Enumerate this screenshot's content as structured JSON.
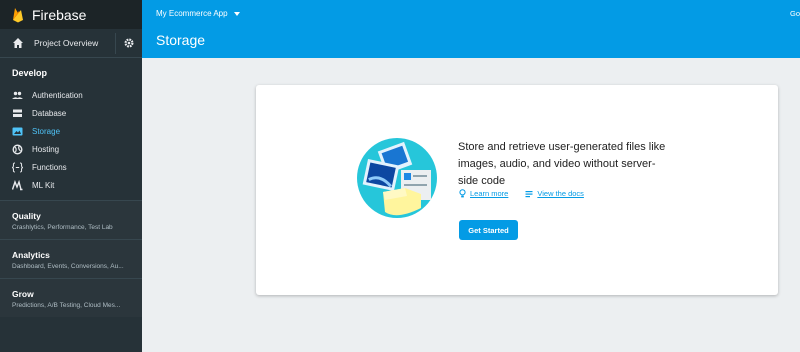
{
  "app": {
    "name": "Firebase"
  },
  "sidebar": {
    "project_overview": "Project Overview",
    "develop": {
      "title": "Develop",
      "items": [
        {
          "label": "Authentication",
          "icon": "people-icon"
        },
        {
          "label": "Database",
          "icon": "database-icon"
        },
        {
          "label": "Storage",
          "icon": "image-folder-icon",
          "active": true
        },
        {
          "label": "Hosting",
          "icon": "globe-icon"
        },
        {
          "label": "Functions",
          "icon": "functions-icon"
        },
        {
          "label": "ML Kit",
          "icon": "ml-kit-icon"
        }
      ]
    },
    "groups": [
      {
        "title": "Quality",
        "subtitle": "Crashlytics, Performance, Test Lab"
      },
      {
        "title": "Analytics",
        "subtitle": "Dashboard, Events, Conversions, Au..."
      },
      {
        "title": "Grow",
        "subtitle": "Predictions, A/B Testing, Cloud Mes..."
      }
    ]
  },
  "header": {
    "project": "My Ecommerce App",
    "title": "Storage",
    "right_text": "Go"
  },
  "card": {
    "description": "Store and retrieve user-generated files like images, audio, and video without server-side code",
    "learn_more": "Learn more",
    "view_docs": "View the docs",
    "get_started": "Get Started"
  },
  "colors": {
    "sidebar_bg": "#263238",
    "header_bg": "#039be5",
    "accent": "#039be5",
    "active_nav": "#4fc3f7",
    "page_bg": "#eceff1"
  }
}
